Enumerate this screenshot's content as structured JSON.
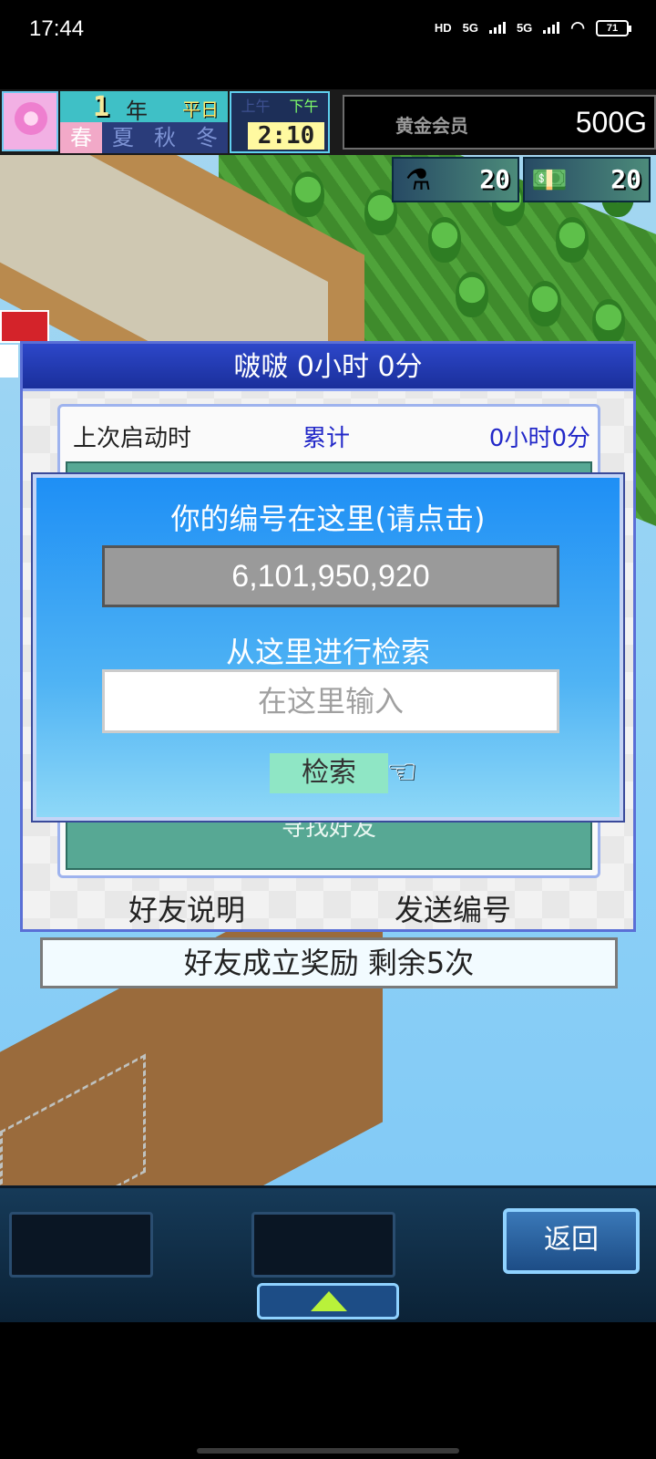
{
  "status_bar": {
    "time": "17:44",
    "network_1": "HD",
    "network_2": "5G",
    "network_3": "5G",
    "battery": "71"
  },
  "hud": {
    "year_number": "1",
    "year_label": "年",
    "day_type": "平日",
    "seasons": [
      "春",
      "夏",
      "秋",
      "冬"
    ],
    "active_season_index": 0,
    "am_label": "上午",
    "pm_label": "下午",
    "clock": "2:10",
    "member_label": "黄金会员",
    "gold": "500G",
    "resource_1_value": "20",
    "resource_1_icon": "flask-icon",
    "resource_2_value": "20",
    "resource_2_icon": "ticket-icon"
  },
  "dialog": {
    "title": "啵啵  0小时 0分",
    "last_start_label": "上次启动时",
    "cumulative_label": "累计",
    "cumulative_value": "0小时0分",
    "find_friends": "寻找好友",
    "friend_info_link": "好友说明",
    "send_id_link": "发送编号"
  },
  "popup": {
    "your_id_label": "你的编号在这里(请点击)",
    "your_id_value": "6,101,950,920",
    "search_label": "从这里进行检索",
    "input_placeholder": "在这里输入",
    "search_button": "检索"
  },
  "reward": {
    "text": "好友成立奖励  剩余5次"
  },
  "bottombar": {
    "back_button": "返回"
  },
  "colors": {
    "popup_top": "#1e8ff5",
    "popup_bottom": "#8ed8f7",
    "dialog_title_bg": "#2d47c9",
    "accent_link": "#2228c8"
  }
}
